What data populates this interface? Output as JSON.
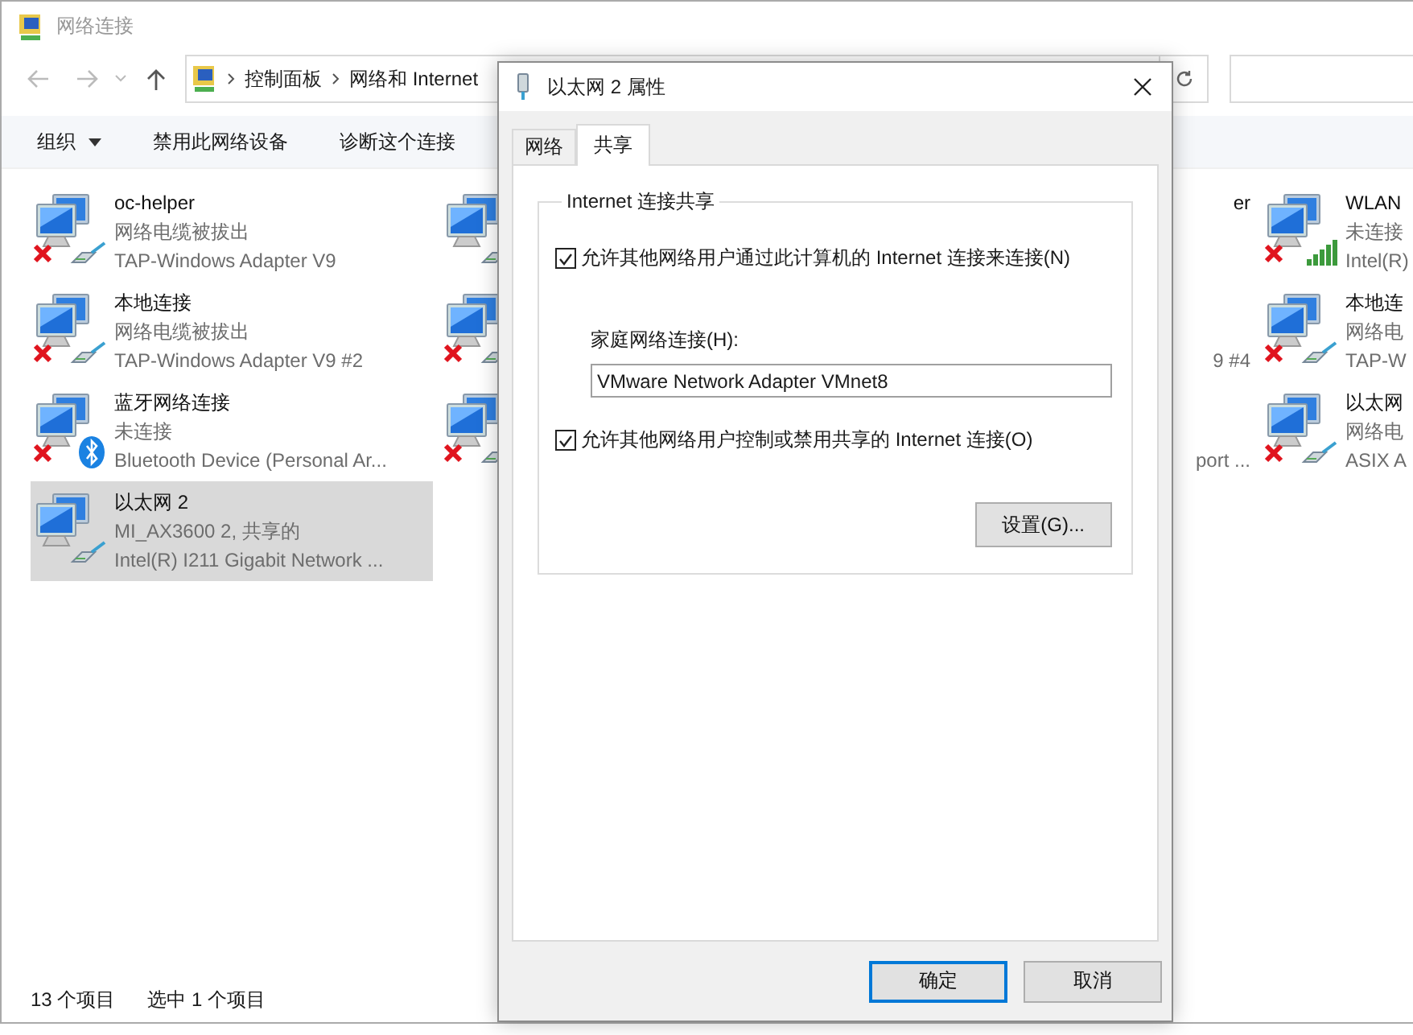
{
  "window": {
    "title": "网络连接"
  },
  "breadcrumb": [
    "控制面板",
    "网络和 Internet"
  ],
  "toolbar": [
    {
      "label": "组织",
      "dropdown": true
    },
    {
      "label": "禁用此网络设备",
      "dropdown": false
    },
    {
      "label": "诊断这个连接",
      "dropdown": false
    }
  ],
  "adapter_columns": [
    {
      "items": [
        {
          "name": "oc-helper",
          "status": "网络电缆被拔出",
          "device": "TAP-Windows Adapter V9",
          "kind": "cable",
          "disconnected": true,
          "selected": false
        },
        {
          "name": "本地连接",
          "status": "网络电缆被拔出",
          "device": "TAP-Windows Adapter V9 #2",
          "kind": "cable",
          "disconnected": true,
          "selected": false
        },
        {
          "name": "蓝牙网络连接",
          "status": "未连接",
          "device": "Bluetooth Device (Personal Ar...",
          "kind": "bluetooth",
          "disconnected": true,
          "selected": false
        },
        {
          "name": "以太网 2",
          "status": "MI_AX3600 2, 共享的",
          "device": "Intel(R) I211 Gigabit Network ...",
          "kind": "cable",
          "disconnected": false,
          "selected": true
        }
      ]
    },
    {
      "items": [
        {
          "kind": "cable",
          "disconnected": false,
          "selected": false
        },
        {
          "kind": "cable",
          "disconnected": true,
          "selected": false
        },
        {
          "kind": "cable",
          "disconnected": true,
          "selected": false
        }
      ]
    },
    {
      "items": [
        {
          "name": "er",
          "selected": false
        },
        {
          "device": "9 #4",
          "selected": false
        },
        {
          "device": "port ...",
          "selected": false
        }
      ]
    },
    {
      "items": [
        {
          "name": "WLAN",
          "status": "未连接",
          "device": "Intel(R)",
          "kind": "wifi",
          "disconnected": true,
          "selected": false
        },
        {
          "name": "本地连",
          "status": "网络电",
          "device": "TAP-W",
          "kind": "cable",
          "disconnected": true,
          "selected": false
        },
        {
          "name": "以太网",
          "status": "网络电",
          "device": "ASIX A",
          "kind": "cable",
          "disconnected": true,
          "selected": false
        }
      ]
    }
  ],
  "status_bar": {
    "count": "13 个项目",
    "selection": "选中 1 个项目"
  },
  "dialog": {
    "title": "以太网 2 属性",
    "tabs": [
      {
        "label": "网络",
        "selected": false
      },
      {
        "label": "共享",
        "selected": true
      }
    ],
    "group_title": "Internet 连接共享",
    "share_option": {
      "label": "允许其他网络用户通过此计算机的 Internet 连接来连接(N)",
      "checked": true
    },
    "home_network": {
      "label": "家庭网络连接(H):",
      "value": "VMware Network Adapter VMnet8"
    },
    "control_option": {
      "label": "允许其他网络用户控制或禁用共享的 Internet 连接(O)",
      "checked": true
    },
    "settings_button": "设置(G)...",
    "buttons": [
      {
        "label": "确定",
        "default": true
      },
      {
        "label": "取消",
        "default": false
      }
    ]
  }
}
